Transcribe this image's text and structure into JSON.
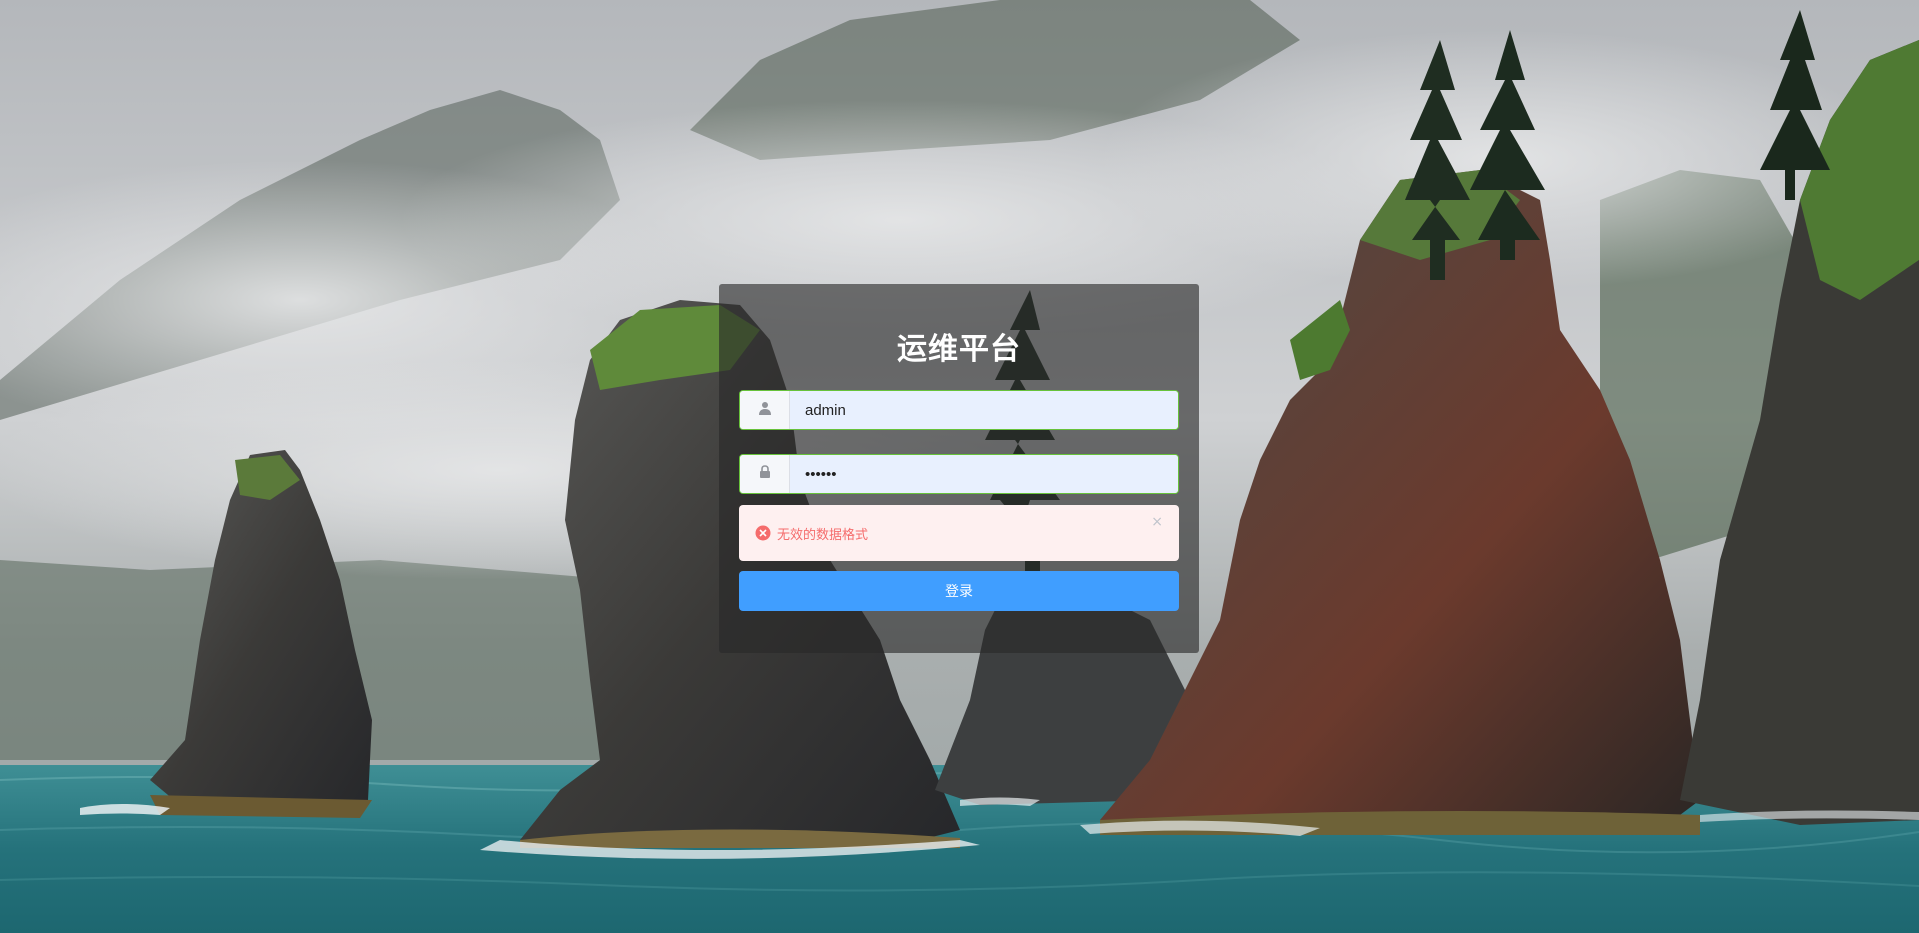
{
  "page": {
    "title": "运维平台"
  },
  "form": {
    "username": {
      "icon": "user-icon",
      "value": "admin"
    },
    "password": {
      "icon": "lock-icon",
      "value": "••••••"
    },
    "alert": {
      "icon": "error-circle-icon",
      "message": "无效的数据格式",
      "close_label": "×",
      "type": "error"
    },
    "submit_label": "登录"
  },
  "colors": {
    "primary": "#409eff",
    "success_border": "#67c23a",
    "error_text": "#f56c6c",
    "error_bg": "#fef0f0",
    "autofill_bg": "#e8f0fe",
    "panel_bg": "rgba(40,40,40,0.62)"
  },
  "background": {
    "icon": "coastal-sea-stacks-landscape"
  }
}
